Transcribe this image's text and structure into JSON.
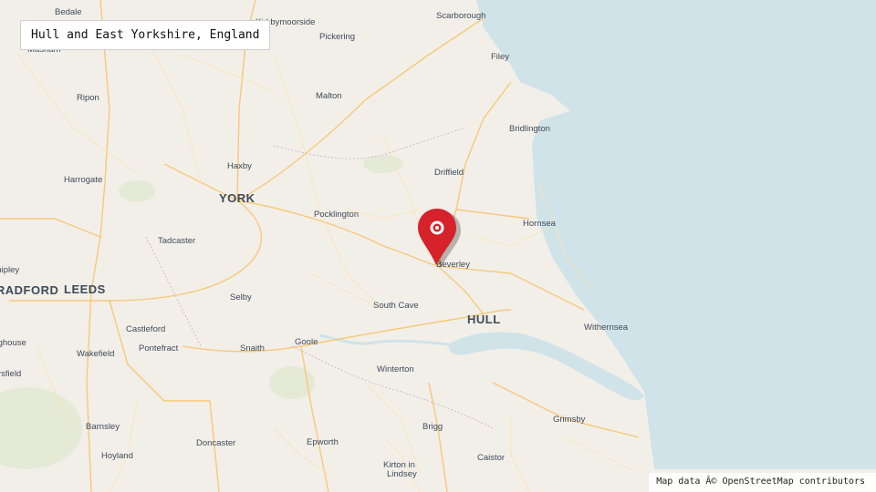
{
  "map": {
    "title": "Hull and East Yorkshire, England",
    "attribution": "Map data Â© OpenStreetMap contributors",
    "colors": {
      "land": "#f2efe9",
      "sea": "#cfe3e8",
      "road_major": "#f6c978",
      "road_minor": "#fbe3b4",
      "marker": "#d6222b"
    },
    "marker": {
      "icon": "location-pin-icon",
      "label": "Beverley"
    },
    "places": {
      "bedale": "Bedale",
      "kirkbymoorside": "Kirkbymoorside",
      "scarborough": "Scarborough",
      "masham": "Masham",
      "pickering": "Pickering",
      "filey": "Filey",
      "ripon": "Ripon",
      "malton": "Malton",
      "bridlington": "Bridlington",
      "haxby": "Haxby",
      "driffield": "Driffield",
      "harrogate": "Harrogate",
      "york": "YORK",
      "pocklington": "Pocklington",
      "hornsea": "Hornsea",
      "tadcaster": "Tadcaster",
      "beverley": "Beverley",
      "shipley": "Shipley",
      "bradford": "BRADFORD",
      "leeds": "LEEDS",
      "selby": "Selby",
      "south_cave": "South Cave",
      "hull": "HULL",
      "castleford": "Castleford",
      "withernsea": "Withernsea",
      "brighouse": "Brighouse",
      "wakefield": "Wakefield",
      "pontefract": "Pontefract",
      "snaith": "Snaith",
      "goole": "Goole",
      "huddersfield": "Huddersfield",
      "winterton": "Winterton",
      "grimsby": "Grimsby",
      "barnsley": "Barnsley",
      "brigg": "Brigg",
      "doncaster": "Doncaster",
      "epworth": "Epworth",
      "hoyland": "Hoyland",
      "caistor": "Caistor",
      "kirton_in_lindsey_1": "Kirton in",
      "kirton_in_lindsey_2": "Lindsey"
    }
  }
}
